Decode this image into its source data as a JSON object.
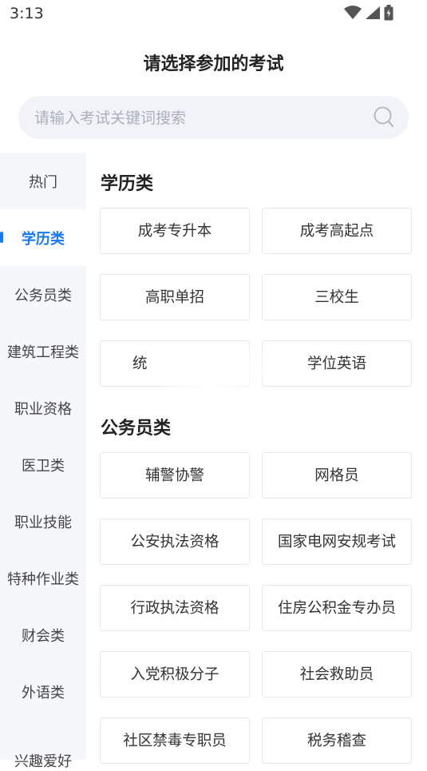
{
  "status_bar": {
    "time": "3:13",
    "icons": [
      "wifi-icon",
      "signal-icon",
      "battery-icon"
    ]
  },
  "header": {
    "title": "请选择参加的考试"
  },
  "search": {
    "placeholder": "请输入考试关键词搜索",
    "value": "",
    "icon": "search-icon"
  },
  "sidebar": {
    "items": [
      {
        "label": "热门",
        "active": false
      },
      {
        "label": "学历类",
        "active": true
      },
      {
        "label": "公务员类",
        "active": false
      },
      {
        "label": "建筑工程类",
        "active": false
      },
      {
        "label": "职业资格",
        "active": false
      },
      {
        "label": "医卫类",
        "active": false
      },
      {
        "label": "职业技能",
        "active": false
      },
      {
        "label": "特种作业类",
        "active": false
      },
      {
        "label": "财会类",
        "active": false
      },
      {
        "label": "外语类",
        "active": false
      },
      {
        "label": "兴趣爱好",
        "active": false
      }
    ]
  },
  "sections": [
    {
      "title": "学历类",
      "items": [
        "成考专升本",
        "成考高起点",
        "高职单招",
        "三校生",
        "统",
        "学位英语"
      ]
    },
    {
      "title": "公务员类",
      "items": [
        "辅警协警",
        "网格员",
        "公安执法资格",
        "国家电网安规考试",
        "行政执法资格",
        "住房公积金专办员",
        "入党积极分子",
        "社会救助员",
        "社区禁毒专职员",
        "税务稽查"
      ]
    }
  ],
  "colors": {
    "accent": "#1677ff",
    "sidebar_bg": "#f5f7fa",
    "card_border": "#e6e8ec"
  }
}
